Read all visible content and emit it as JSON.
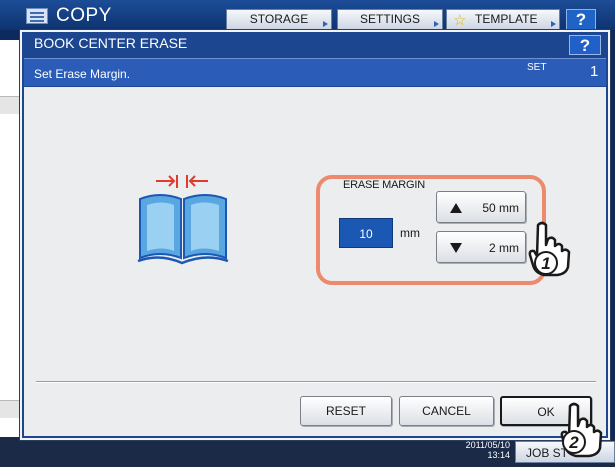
{
  "app": {
    "title": "COPY"
  },
  "top_tabs": {
    "storage": "STORAGE",
    "settings": "SETTINGS",
    "template": "TEMPLATE"
  },
  "help_label": "?",
  "dialog": {
    "title": "BOOK CENTER ERASE",
    "message": "Set Erase Margin.",
    "set_label": "SET",
    "set_number": "1"
  },
  "erase_margin": {
    "label": "ERASE MARGIN",
    "value": "10",
    "unit": "mm",
    "up_label": "50 mm",
    "down_label": "2 mm"
  },
  "actions": {
    "reset": "RESET",
    "cancel": "CANCEL",
    "ok": "OK"
  },
  "status": {
    "date": "2011/05/10",
    "time": "13:14",
    "job_status": "JOB ST"
  },
  "callouts": {
    "step1": "1",
    "step2": "2"
  },
  "colors": {
    "header": "#1d4690",
    "message_bar": "#2a5cb8",
    "value_fill": "#1b58b3",
    "highlight": "#ec8a6d",
    "book_arrows": "#e23a2e",
    "book_page": "#5aa6e0"
  },
  "icons": [
    "copy-app-icon",
    "star-icon",
    "book-center-erase-icon",
    "up-triangle-icon",
    "down-triangle-icon",
    "pointing-hand-icon"
  ]
}
